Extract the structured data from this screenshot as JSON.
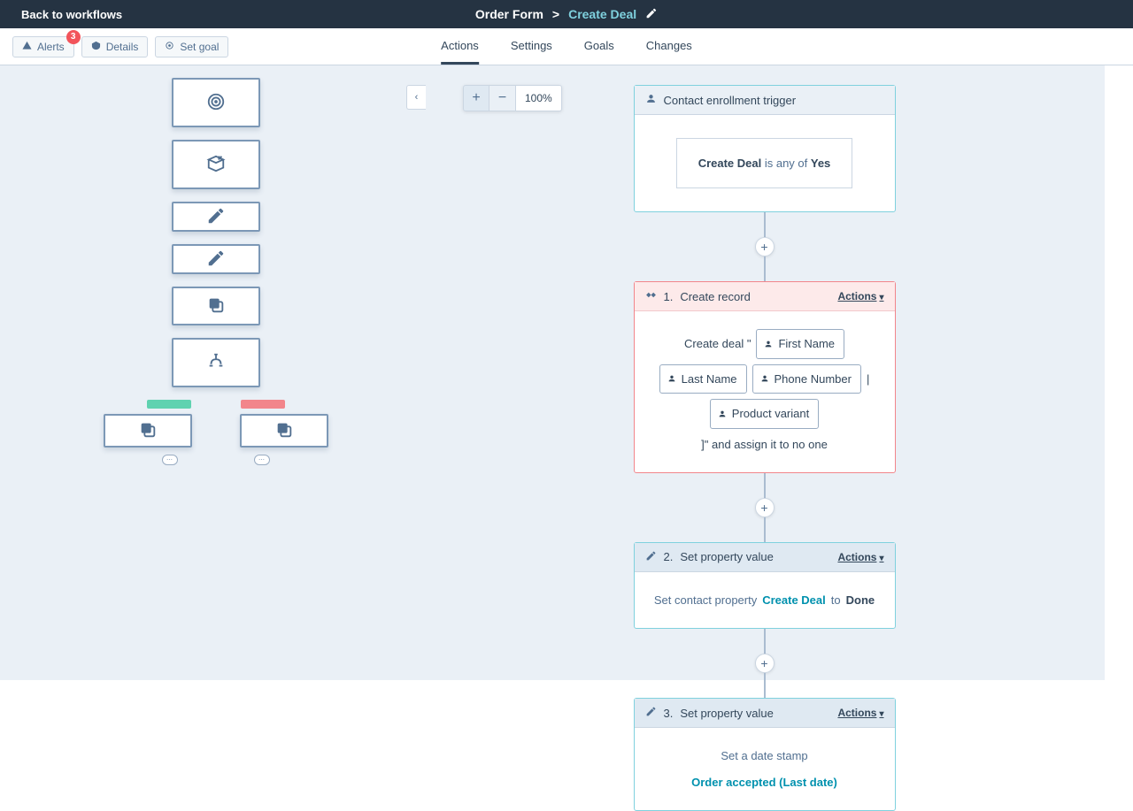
{
  "topbar": {
    "back": "Back to workflows",
    "breadcrumb1": "Order Form",
    "breadcrumb2": "Create Deal"
  },
  "subbar": {
    "alerts": "Alerts",
    "alerts_count": "3",
    "details": "Details",
    "set_goal": "Set goal"
  },
  "tabs": {
    "actions": "Actions",
    "settings": "Settings",
    "goals": "Goals",
    "changes": "Changes"
  },
  "zoom": {
    "plus": "+",
    "minus": "−",
    "pct": "100%"
  },
  "trigger": {
    "title": "Contact enrollment trigger",
    "chip_strong": "Create Deal",
    "chip_mid": " is any of ",
    "chip_end": "Yes"
  },
  "step1": {
    "num": "1.",
    "title": "Create record",
    "actions": "Actions",
    "pre": "Create deal \"",
    "token1": "First Name",
    "token2": "Last Name",
    "token3": "Phone Number",
    "mid": "|",
    "token4": "Product variant",
    "post": "]\" and assign it to no one"
  },
  "step2": {
    "num": "2.",
    "title": "Set property value",
    "actions": "Actions",
    "body_pre": "Set contact property ",
    "body_link": "Create Deal",
    "body_mid": " to ",
    "body_end": "Done"
  },
  "step3": {
    "num": "3.",
    "title": "Set property value",
    "actions": "Actions",
    "body_pre": "Set a date stamp ",
    "body_link": "Order accepted (Last date)"
  }
}
